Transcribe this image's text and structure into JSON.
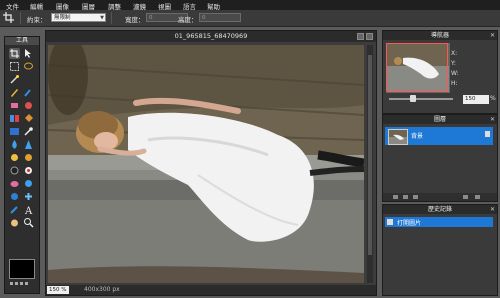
{
  "menu": [
    "文件",
    "編輯",
    "圖像",
    "圖層",
    "調整",
    "濾鏡",
    "視圖",
    "語言",
    "幫助"
  ],
  "options": {
    "constraint_label": "約束：",
    "constraint_value": "無限制",
    "width_label": "寬度：",
    "width_value": "0",
    "height_label": "高度：",
    "height_value": "0"
  },
  "toolbox": {
    "title": "工具"
  },
  "document": {
    "title": "01_965815_68470969",
    "zoom": "150 %",
    "size": "400x300 px"
  },
  "navigator": {
    "title": "導航器",
    "x_label": "X:",
    "y_label": "Y:",
    "w_label": "W:",
    "h_label": "H:",
    "zoom": "150",
    "zoom_unit": "%"
  },
  "layers": {
    "title": "圖層",
    "items": [
      {
        "name": "背景"
      }
    ]
  },
  "history": {
    "title": "歷史記錄",
    "items": [
      {
        "name": "打開圖片"
      }
    ]
  },
  "colors": {
    "accent": "#1e78d6",
    "foreground": "#000000"
  }
}
